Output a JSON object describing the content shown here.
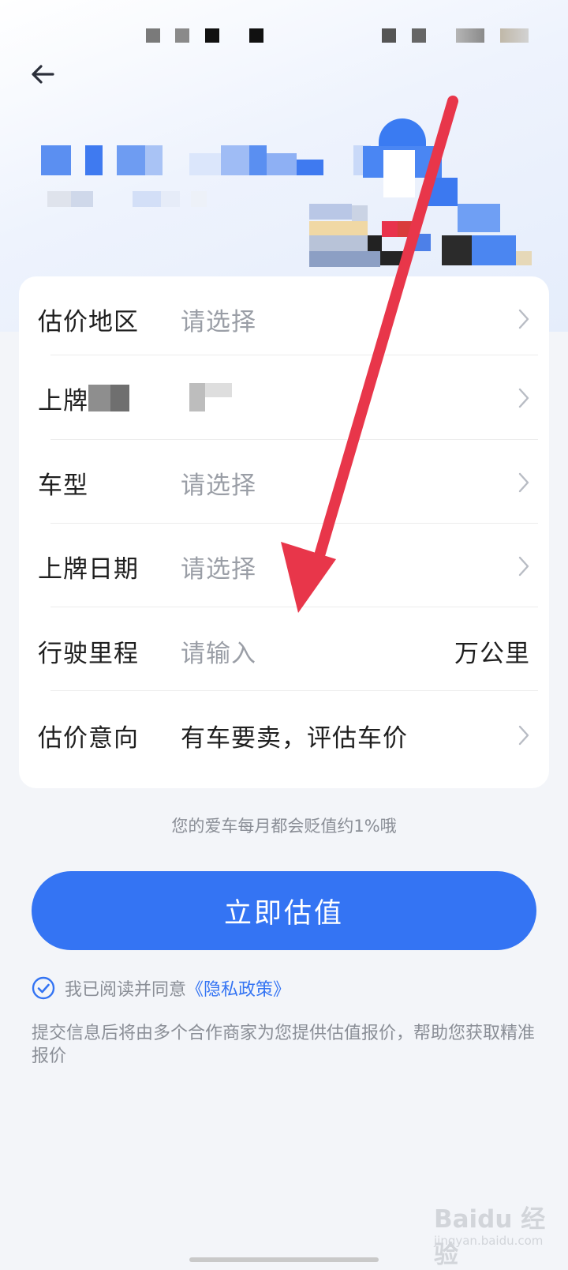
{
  "form": {
    "rows": [
      {
        "label": "估价地区",
        "value": "请选择"
      },
      {
        "label": "上牌",
        "value": ""
      },
      {
        "label": "车型",
        "value": "请选择"
      },
      {
        "label": "上牌日期",
        "value": "请选择"
      },
      {
        "label": "行驶里程",
        "value": "请输入",
        "unit": "万公里"
      },
      {
        "label": "估价意向",
        "value": "有车要卖，评估车价"
      }
    ]
  },
  "tip": "您的爱车每月都会贬值约1%哦",
  "submit_label": "立即估值",
  "agreement": {
    "text": "我已阅读并同意",
    "link": "《隐私政策》"
  },
  "disclaimer": "提交信息后将由多个合作商家为您提供估值报价，帮助您获取精准报价",
  "watermark": {
    "brand": "Baidu 经验",
    "sub": "jingyan.baidu.com"
  },
  "colors": {
    "accent": "#3474f3",
    "annotation_arrow": "#e8364a"
  }
}
